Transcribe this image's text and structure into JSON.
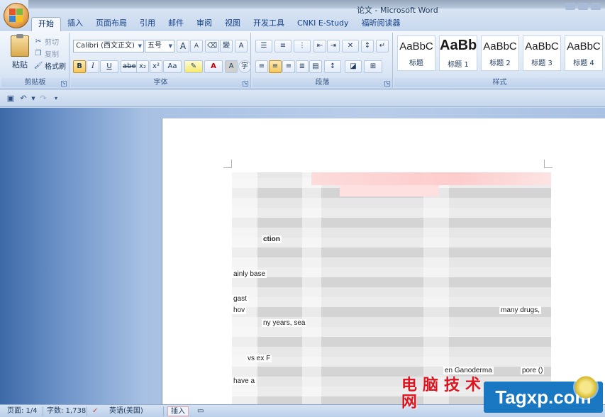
{
  "window": {
    "title": "论文 - Microsoft Word"
  },
  "tabs": [
    "开始",
    "插入",
    "页面布局",
    "引用",
    "邮件",
    "审阅",
    "视图",
    "开发工具",
    "CNKI E-Study",
    "福昕阅读器"
  ],
  "clipboard": {
    "group_label": "剪贴板",
    "paste": "粘贴",
    "cut": "剪切",
    "copy": "复制",
    "format_painter": "格式刷"
  },
  "font": {
    "group_label": "字体",
    "font_name": "Calibri (西文正文)",
    "font_size": "五号",
    "grow": "A",
    "shrink": "A",
    "bold": "B",
    "italic": "I",
    "underline": "U",
    "strike": "abe",
    "subscript": "x₂",
    "superscript": "x²",
    "change_case": "Aa",
    "font_color": "A",
    "char_shading": "A",
    "phonetic": "變",
    "border_char": "A",
    "enclose": "字"
  },
  "paragraph": {
    "group_label": "段落"
  },
  "styles": {
    "group_label": "样式",
    "items": [
      {
        "sample": "AaBbC",
        "name": "标题"
      },
      {
        "sample": "AaBb",
        "name": "标题 1"
      },
      {
        "sample": "AaBbC",
        "name": "标题 2"
      },
      {
        "sample": "AaBbC",
        "name": "标题 3"
      },
      {
        "sample": "AaBbC",
        "name": "标题 4"
      }
    ]
  },
  "document": {
    "fragments": [
      "ction",
      "ainly base",
      "gast",
      "hov",
      "ny years, sea",
      "many drugs,",
      "vs  ex F",
      "en Ganoderma",
      "pore ()",
      "have a"
    ]
  },
  "status": {
    "page": "页面: 1/4",
    "words": "字数: 1,738",
    "language": "英语(美国)",
    "mode": "插入"
  },
  "watermark": {
    "cn": "电脑技术网",
    "en": "Tagxp.com"
  }
}
